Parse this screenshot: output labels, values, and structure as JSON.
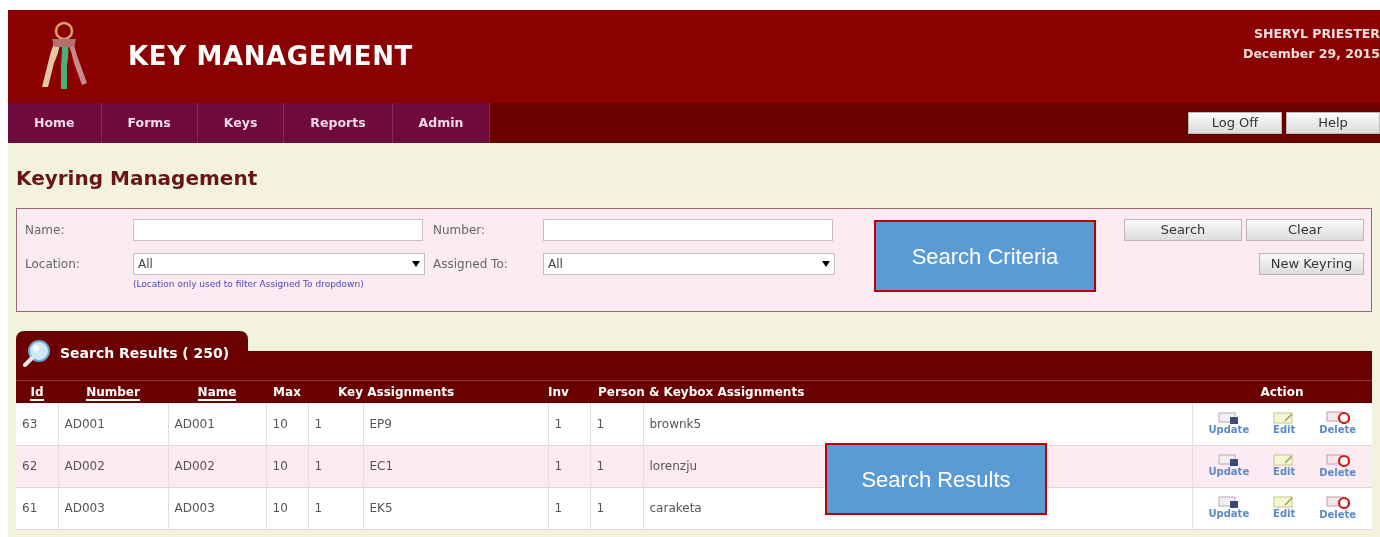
{
  "header": {
    "title": "KEY MANAGEMENT",
    "user": "SHERYL PRIESTER",
    "date": "December 29, 2015"
  },
  "nav": [
    "Home",
    "Forms",
    "Keys",
    "Reports",
    "Admin"
  ],
  "header_buttons": [
    "Log Off",
    "Help"
  ],
  "page_title": "Keyring Management",
  "search": {
    "fields": [
      {
        "label": "Name:",
        "kind": "text"
      },
      {
        "label": "Number:",
        "kind": "text"
      },
      {
        "label": "Location:",
        "kind": "select",
        "value": "All"
      },
      {
        "label": "Assigned To:",
        "kind": "select",
        "value": "All"
      }
    ],
    "hint": "(Location only used to filter Assigned To dropdown)",
    "buttons": [
      "Search",
      "Clear",
      "New Keyring"
    ]
  },
  "results": {
    "title": "Search Results ( 250)",
    "columns": [
      {
        "label": "Id",
        "sortable": true
      },
      {
        "label": "Number",
        "sortable": true
      },
      {
        "label": "Name",
        "sortable": true
      },
      {
        "label": "Max",
        "sortable": false
      },
      {
        "label": "Key Assignments",
        "sortable": false
      },
      null,
      {
        "label": "Inv",
        "sortable": false
      },
      {
        "label": "Person & Keybox Assignments",
        "sortable": false
      },
      null,
      {
        "label": "Action",
        "sortable": false
      }
    ],
    "rows": [
      {
        "cells": [
          "63",
          "AD001",
          "AD001",
          "10",
          "1",
          "EP9",
          "1",
          "1",
          "brownk5"
        ],
        "actions": [
          "Update",
          "Edit",
          "Delete"
        ]
      },
      {
        "cells": [
          "62",
          "AD002",
          "AD002",
          "10",
          "1",
          "EC1",
          "1",
          "1",
          "lorenzju"
        ],
        "actions": [
          "Update",
          "Edit",
          "Delete"
        ]
      },
      {
        "cells": [
          "61",
          "AD003",
          "AD003",
          "10",
          "1",
          "EK5",
          "1",
          "1",
          "caraketa"
        ],
        "actions": [
          "Update",
          "Edit",
          "Delete"
        ]
      }
    ]
  },
  "annotations": [
    "Search Criteria",
    "Search Results"
  ]
}
